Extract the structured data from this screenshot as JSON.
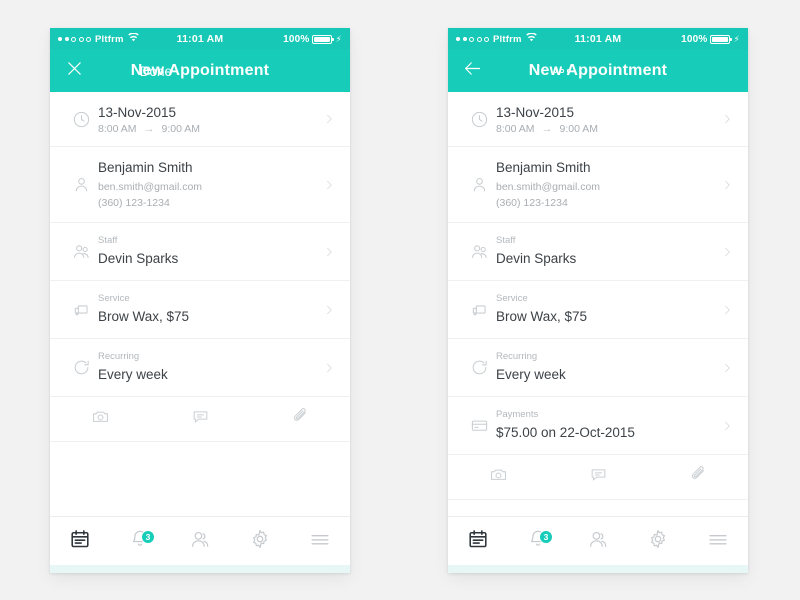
{
  "theme": {
    "accent": "#17cdb9",
    "statusbar_bg": "#16c8b5",
    "page_bg": "#f2f2f2",
    "text_primary": "#3c4247",
    "text_muted": "#a9aeb2",
    "label_muted": "#b3b8bc",
    "icon_gray": "#c9cdd0",
    "tab_active": "#2e363c",
    "badge_bg": "#17cdb9"
  },
  "status_bar": {
    "signal_dots_filled": 2,
    "signal_dots_total": 5,
    "carrier": "Pltfrm",
    "wifi_icon": "wifi-icon",
    "time": "11:01 AM",
    "battery_percent": "100%",
    "battery_icon": "battery-full-icon",
    "charging_icon": "lightning-bolt-icon"
  },
  "screens": [
    {
      "id": "left",
      "nav": {
        "left_action": {
          "name": "close-button",
          "icon": "close-x-icon",
          "label": ""
        },
        "title": "New Appointment",
        "right_action": {
          "name": "done-button",
          "icon": "",
          "label": "Done"
        }
      },
      "rows": [
        {
          "name": "row-datetime",
          "icon": "clock-icon",
          "label": "",
          "title": "13-Nov-2015",
          "time_start": "8:00 AM",
          "time_arrow": "→",
          "time_end": "9:00 AM",
          "sub": "",
          "sub2": "",
          "chevron": "chevron-right-icon"
        },
        {
          "name": "row-client",
          "icon": "person-icon",
          "label": "",
          "title": "Benjamin Smith",
          "sub": "ben.smith@gmail.com",
          "sub2": "(360) 123-1234",
          "chevron": "chevron-right-icon"
        },
        {
          "name": "row-staff",
          "icon": "two-people-icon",
          "label": "Staff",
          "title": "Devin Sparks",
          "sub": "",
          "sub2": "",
          "chevron": "chevron-right-icon"
        },
        {
          "name": "row-service",
          "icon": "service-truck-icon",
          "label": "Service",
          "title": "Brow Wax, $75",
          "sub": "",
          "sub2": "",
          "chevron": "chevron-right-icon"
        },
        {
          "name": "row-recurring",
          "icon": "refresh-icon",
          "label": "Recurring",
          "title": "Every week",
          "sub": "",
          "sub2": "",
          "chevron": "chevron-right-icon"
        }
      ],
      "attachments": [
        {
          "name": "attach-photo-button",
          "icon": "camera-icon"
        },
        {
          "name": "attach-note-button",
          "icon": "chat-bubble-icon"
        },
        {
          "name": "attach-file-button",
          "icon": "paperclip-icon"
        }
      ],
      "tabs": [
        {
          "name": "tab-calendar",
          "icon": "calendar-icon",
          "active": true,
          "badge": ""
        },
        {
          "name": "tab-notifications",
          "icon": "bell-icon",
          "active": false,
          "badge": "3"
        },
        {
          "name": "tab-clients",
          "icon": "people-icon",
          "active": false,
          "badge": ""
        },
        {
          "name": "tab-settings",
          "icon": "gear-icon",
          "active": false,
          "badge": ""
        },
        {
          "name": "tab-menu",
          "icon": "hamburger-icon",
          "active": false,
          "badge": ""
        }
      ]
    },
    {
      "id": "right",
      "nav": {
        "left_action": {
          "name": "back-button",
          "icon": "arrow-left-icon",
          "label": ""
        },
        "title": "New Appointment",
        "right_action": {
          "name": "overflow-menu-button",
          "icon": "kebab-dots-icon",
          "label": ""
        }
      },
      "rows": [
        {
          "name": "row-datetime",
          "icon": "clock-icon",
          "label": "",
          "title": "13-Nov-2015",
          "time_start": "8:00 AM",
          "time_arrow": "→",
          "time_end": "9:00 AM",
          "sub": "",
          "sub2": "",
          "chevron": "chevron-right-icon"
        },
        {
          "name": "row-client",
          "icon": "person-icon",
          "label": "",
          "title": "Benjamin Smith",
          "sub": "ben.smith@gmail.com",
          "sub2": "(360) 123-1234",
          "chevron": "chevron-right-icon"
        },
        {
          "name": "row-staff",
          "icon": "two-people-icon",
          "label": "Staff",
          "title": "Devin Sparks",
          "sub": "",
          "sub2": "",
          "chevron": "chevron-right-icon"
        },
        {
          "name": "row-service",
          "icon": "service-truck-icon",
          "label": "Service",
          "title": "Brow Wax, $75",
          "sub": "",
          "sub2": "",
          "chevron": "chevron-right-icon"
        },
        {
          "name": "row-recurring",
          "icon": "refresh-icon",
          "label": "Recurring",
          "title": "Every week",
          "sub": "",
          "sub2": "",
          "chevron": "chevron-right-icon"
        },
        {
          "name": "row-payments",
          "icon": "credit-card-icon",
          "label": "Payments",
          "title": "$75.00 on 22-Oct-2015",
          "sub": "",
          "sub2": "",
          "chevron": "chevron-right-icon"
        }
      ],
      "attachments": [
        {
          "name": "attach-photo-button",
          "icon": "camera-icon"
        },
        {
          "name": "attach-note-button",
          "icon": "chat-bubble-icon"
        },
        {
          "name": "attach-file-button",
          "icon": "paperclip-icon"
        }
      ],
      "tabs": [
        {
          "name": "tab-calendar",
          "icon": "calendar-icon",
          "active": true,
          "badge": ""
        },
        {
          "name": "tab-notifications",
          "icon": "bell-icon",
          "active": false,
          "badge": "3"
        },
        {
          "name": "tab-clients",
          "icon": "people-icon",
          "active": false,
          "badge": ""
        },
        {
          "name": "tab-settings",
          "icon": "gear-icon",
          "active": false,
          "badge": ""
        },
        {
          "name": "tab-menu",
          "icon": "hamburger-icon",
          "active": false,
          "badge": ""
        }
      ]
    }
  ]
}
